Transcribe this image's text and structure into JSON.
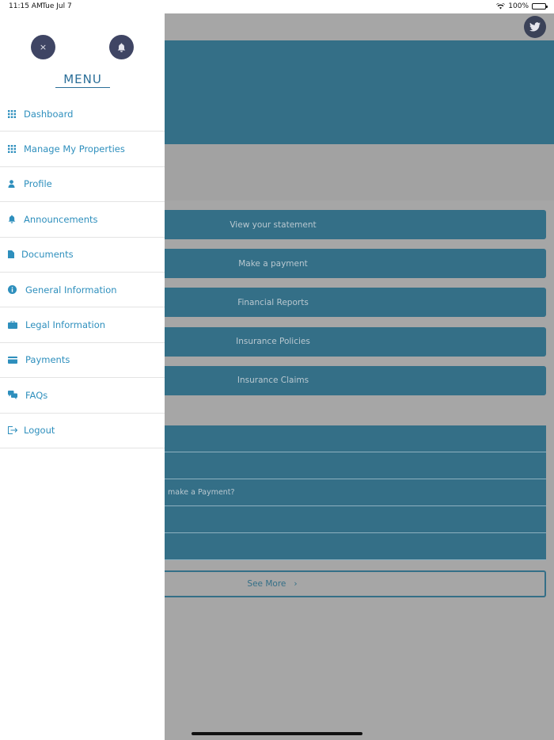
{
  "status_bar": {
    "time": "11:15 AM",
    "date": "Tue Jul 7",
    "battery": "100%"
  },
  "menu": {
    "title": "MENU",
    "close_glyph": "×",
    "items": [
      {
        "label": "Dashboard",
        "icon": "grid-icon"
      },
      {
        "label": "Manage My Properties",
        "icon": "grid-icon"
      },
      {
        "label": "Profile",
        "icon": "user-icon"
      },
      {
        "label": "Announcements",
        "icon": "bell-icon"
      },
      {
        "label": "Documents",
        "icon": "document-icon"
      },
      {
        "label": "General Information",
        "icon": "info-icon"
      },
      {
        "label": "Legal Information",
        "icon": "briefcase-icon"
      },
      {
        "label": "Payments",
        "icon": "credit-card-icon"
      },
      {
        "label": "FAQs",
        "icon": "chat-icon"
      },
      {
        "label": "Logout",
        "icon": "logout-icon"
      }
    ]
  },
  "main": {
    "actions": [
      "View your statement",
      "Make a payment",
      "Financial Reports",
      "Insurance Policies",
      "Insurance Claims"
    ],
    "faq_partial": [
      "",
      "",
      "make a Payment?",
      "",
      ""
    ],
    "see_more": "See More",
    "see_more_chevron": "›"
  },
  "colors": {
    "accent": "#346f87",
    "menu_text": "#2e8fbd",
    "circle_button": "#3f4564"
  }
}
